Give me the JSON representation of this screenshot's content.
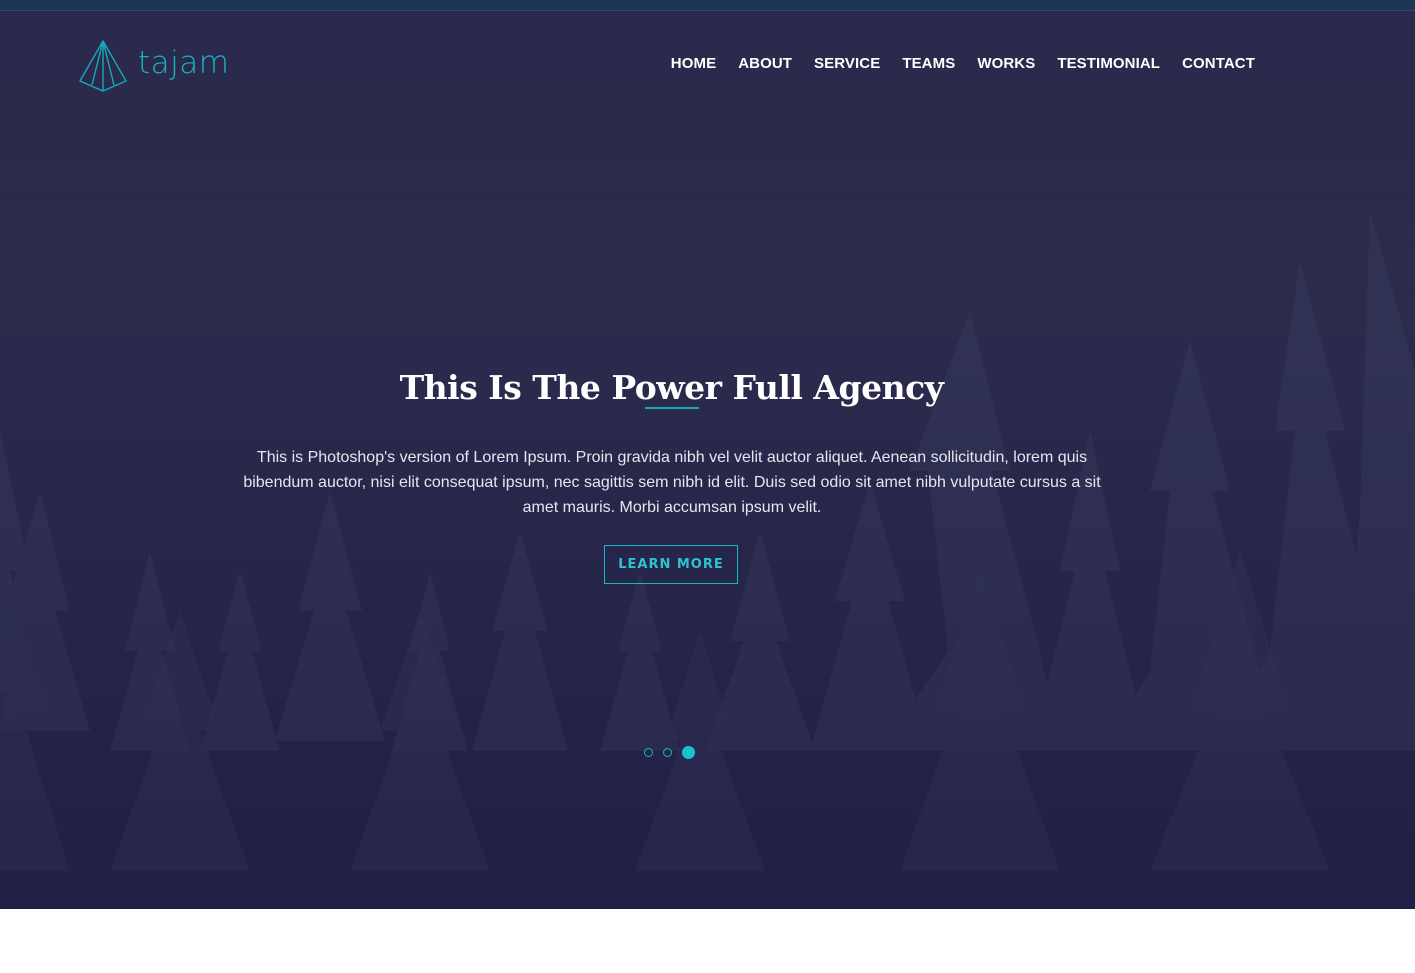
{
  "brand": {
    "name": "tajam",
    "logo_icon": "pyramid-logo-icon",
    "accent_color": "#16b8c6"
  },
  "nav": {
    "items": [
      {
        "label": "HOME"
      },
      {
        "label": "ABOUT"
      },
      {
        "label": "SERVICE"
      },
      {
        "label": "TEAMS"
      },
      {
        "label": "WORKS"
      },
      {
        "label": "TESTIMONIAL"
      },
      {
        "label": "CONTACT"
      }
    ]
  },
  "hero": {
    "title": "This Is The Power Full Agency",
    "description": "This is Photoshop's version of Lorem Ipsum. Proin gravida nibh vel velit auctor aliquet. Aenean sollicitudin, lorem quis bibendum auctor, nisi elit consequat ipsum, nec sagittis sem nibh id elit. Duis sed odio sit amet nibh vulputate cursus a sit amet mauris. Morbi accumsan ipsum velit.",
    "cta_label": "LEARN MORE",
    "background": "forest-trees-image",
    "overlay_color": "#1d1a3f"
  },
  "slider": {
    "total": 3,
    "active_index": 3
  }
}
